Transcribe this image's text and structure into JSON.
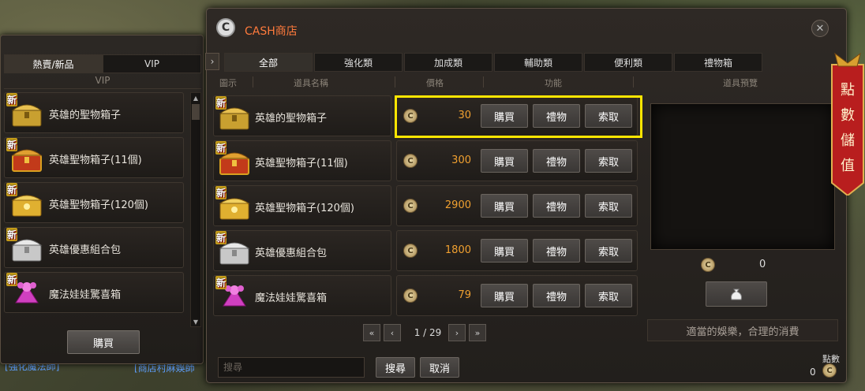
{
  "background": {
    "tag_left": "[強化魔法師]",
    "tag_mid": "[商店村麻娛師"
  },
  "left_panel": {
    "tabs": [
      {
        "label": "熱賣/新品",
        "active": true
      },
      {
        "label": "VIP",
        "active": false
      }
    ],
    "subheader": "VIP",
    "items": [
      {
        "name": "英雄的聖物箱子",
        "icon": "gold-chest-icon",
        "badge": "新"
      },
      {
        "name": "英雄聖物箱子(11個)",
        "icon": "red-chest-icon",
        "badge": "新"
      },
      {
        "name": "英雄聖物箱子(120個)",
        "icon": "gold-ornate-chest-icon",
        "badge": "新"
      },
      {
        "name": "英雄優惠組合包",
        "icon": "silver-chest-icon",
        "badge": "新"
      },
      {
        "name": "魔法娃娃驚喜箱",
        "icon": "pink-gift-icon",
        "badge": "新"
      }
    ],
    "buy_label": "購買"
  },
  "shop": {
    "title": "CASH商店",
    "logo": "C",
    "close": "✕",
    "collapse": "›",
    "tabs": [
      {
        "label": "全部",
        "active": true
      },
      {
        "label": "強化類",
        "active": false
      },
      {
        "label": "加成類",
        "active": false
      },
      {
        "label": "輔助類",
        "active": false
      },
      {
        "label": "便利類",
        "active": false
      },
      {
        "label": "禮物箱",
        "active": false
      }
    ],
    "columns": {
      "icon": "圖示",
      "name": "道具名稱",
      "price": "價格",
      "function": "功能",
      "preview": "道具預覽"
    },
    "items": [
      {
        "name": "英雄的聖物箱子",
        "price": "30",
        "icon": "gold-chest-icon",
        "badge": "新",
        "buy": "購買",
        "gift": "禮物",
        "request": "索取"
      },
      {
        "name": "英雄聖物箱子(11個)",
        "price": "300",
        "icon": "red-chest-icon",
        "badge": "新",
        "buy": "購買",
        "gift": "禮物",
        "request": "索取"
      },
      {
        "name": "英雄聖物箱子(120個)",
        "price": "2900",
        "icon": "gold-ornate-chest-icon",
        "badge": "新",
        "buy": "購買",
        "gift": "禮物",
        "request": "索取"
      },
      {
        "name": "英雄優惠組合包",
        "price": "1800",
        "icon": "silver-chest-icon",
        "badge": "新",
        "buy": "購買",
        "gift": "禮物",
        "request": "索取"
      },
      {
        "name": "魔法娃娃驚喜箱",
        "price": "79",
        "icon": "pink-gift-icon",
        "badge": "新",
        "buy": "購買",
        "gift": "禮物",
        "request": "索取"
      }
    ],
    "pagination": {
      "first": "«",
      "prev": "‹",
      "page": "1 / 29",
      "next": "›",
      "last": "»"
    },
    "preview": {
      "points": "0",
      "slogan": "適當的娛樂，合理的消費"
    },
    "search": {
      "placeholder": "搜尋",
      "search_label": "搜尋",
      "cancel_label": "取消"
    },
    "points": {
      "label": "點數",
      "value": "0"
    },
    "coin_glyph": "C"
  },
  "banner": {
    "text": [
      "點",
      "數",
      "儲",
      "值"
    ]
  },
  "colors": {
    "price": "#f0a030",
    "title": "#ff7a3c",
    "highlight": "#ffe600",
    "banner": "#b81e1e"
  }
}
